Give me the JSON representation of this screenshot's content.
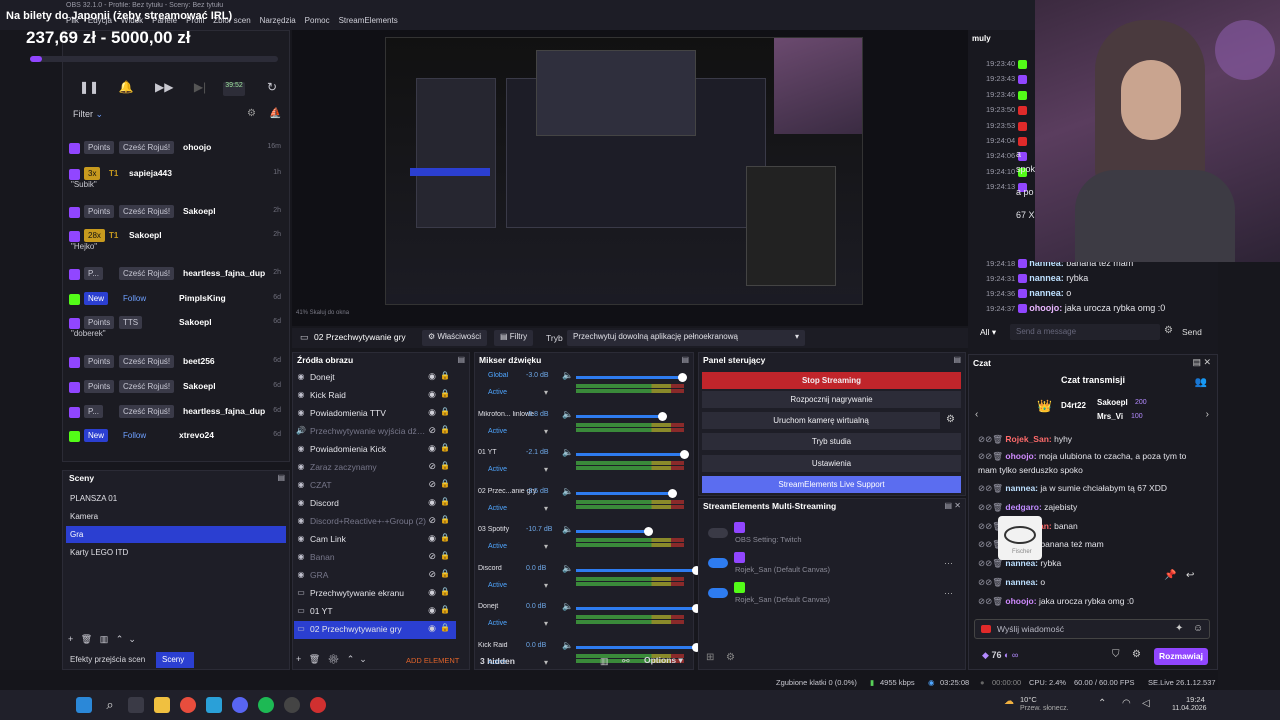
{
  "window": {
    "title": "OBS 32.1.0 - Profile: Bez tytułu - Sceny: Bez tytułu",
    "menu": [
      "Plik",
      "Edycja",
      "Widok",
      "Panele",
      "Profil",
      "Zbiór scen",
      "Narzędzia",
      "Pomoc",
      "StreamElements"
    ]
  },
  "overlay": {
    "stream_title": "Na bilety do Japonii (żeby streamować IRL)",
    "goal_text": "237,69 zł - 5000,00 zł",
    "goal_progress": 0.0475
  },
  "feed": {
    "filter_label": "Filter",
    "timer": "39:52",
    "items": [
      {
        "tag": "Points",
        "tag2": "Cześć Rojuś!",
        "name": "ohoojo",
        "time": "16m",
        "sub": ""
      },
      {
        "tag": "3x",
        "tag2": "T1",
        "name": "sapieja443",
        "time": "1h",
        "sub": "\"Subik\""
      },
      {
        "tag": "Points",
        "tag2": "Cześć Rojuś!",
        "name": "Sakoepl",
        "time": "2h",
        "sub": ""
      },
      {
        "tag": "28x",
        "tag2": "T1",
        "name": "Sakoepl",
        "time": "2h",
        "sub": "\"Hejko\""
      },
      {
        "tag": "P...",
        "tag2": "Cześć Rojuś!",
        "name": "heartless_fajna_dup",
        "time": "2h",
        "sub": ""
      },
      {
        "tag": "New",
        "tag2": "Follow",
        "name": "PimpIsKing",
        "time": "6d",
        "sub": ""
      },
      {
        "tag": "Points",
        "tag2": "TTS",
        "name": "Sakoepl",
        "time": "6d",
        "sub": "\"doberek\""
      },
      {
        "tag": "Points",
        "tag2": "Cześć Rojuś!",
        "name": "beet256",
        "time": "6d",
        "sub": ""
      },
      {
        "tag": "Points",
        "tag2": "Cześć Rojuś!",
        "name": "Sakoepl",
        "time": "6d",
        "sub": ""
      },
      {
        "tag": "P...",
        "tag2": "Cześć Rojuś!",
        "name": "heartless_fajna_dup",
        "time": "6d",
        "sub": ""
      },
      {
        "tag": "New",
        "tag2": "Follow",
        "name": "xtrevo24",
        "time": "6d",
        "sub": ""
      }
    ]
  },
  "scenes": {
    "title": "Sceny",
    "items": [
      "PLANSZA 01",
      "Kamera",
      "Gra",
      "Karty LEGO ITD"
    ],
    "selected_index": 2,
    "tab_transitions": "Efekty przejścia scen",
    "tab_scenes": "Sceny"
  },
  "scene_bar": {
    "current_source": "02 Przechwytywanie gry",
    "properties": "Właściwości",
    "filters": "Filtry",
    "mode_label": "Tryb",
    "mode_value": "Przechwytuj dowolną aplikację pełnoekranową"
  },
  "preview_footer": "41%   Skaluj do okna",
  "sources": {
    "title": "Źródła obrazu",
    "add_label": "ADD ELEMENT",
    "items": [
      {
        "name": "Donejt",
        "dim": false
      },
      {
        "name": "Kick Raid",
        "dim": false
      },
      {
        "name": "Powiadomienia TTV",
        "dim": false
      },
      {
        "name": "Przechwytywanie wyjścia dźwięk",
        "dim": true
      },
      {
        "name": "Powiadomienia Kick",
        "dim": false
      },
      {
        "name": "Zaraz zaczynamy",
        "dim": true
      },
      {
        "name": "CZAT",
        "dim": true
      },
      {
        "name": "Discord",
        "dim": false
      },
      {
        "name": "Discord+Reactive+-+Group (2)",
        "dim": true
      },
      {
        "name": "Cam Link",
        "dim": false
      },
      {
        "name": "Banan",
        "dim": true
      },
      {
        "name": "GRA",
        "dim": true
      },
      {
        "name": "Przechwytywanie ekranu",
        "dim": false
      },
      {
        "name": "01 YT",
        "dim": false
      },
      {
        "name": "02 Przechwytywanie gry",
        "dim": false
      }
    ]
  },
  "mixer": {
    "title": "Mikser dźwięku",
    "hidden_label": "3 hidden",
    "options_label": "Options",
    "tracks": [
      {
        "name": "Global",
        "db": "-3.0 dB",
        "level": 0.88
      },
      {
        "name": "Mikrofon... linlowe",
        "db": "-5.8 dB",
        "level": 0.72
      },
      {
        "name": "01 YT",
        "db": "-2.1 dB",
        "level": 0.9
      },
      {
        "name": "02 Przec...anie gry",
        "db": "-3.5 dB",
        "level": 0.8
      },
      {
        "name": "03 Spotify",
        "db": "-10.7 dB",
        "level": 0.6
      },
      {
        "name": "Discord",
        "db": "0.0 dB",
        "level": 1.0
      },
      {
        "name": "Donejt",
        "db": "0.0 dB",
        "level": 1.0
      },
      {
        "name": "Kick Raid",
        "db": "0.0 dB",
        "level": 1.0
      }
    ],
    "active_label": "Active"
  },
  "controls": {
    "title": "Panel sterujący",
    "buttons": [
      "Stop Streaming",
      "Rozpocznij nagrywanie",
      "Uruchom kamerę wirtualną",
      "Tryb studia",
      "Ustawienia",
      "StreamElements Live Support"
    ]
  },
  "multistream": {
    "title": "StreamElements Multi-Streaming",
    "rows": [
      "OBS Setting: Twitch",
      "Rojek_San (Default Canvas)",
      "Rojek_San (Default Canvas)"
    ]
  },
  "chat_top": {
    "user": "muly",
    "times": [
      "19:23:40",
      "19:23:43",
      "19:23:46",
      "19:23:50",
      "19:23:53",
      "19:24:04",
      "19:24:06",
      "19:24:10",
      "19:24:13",
      "19:24:18",
      "19:24:31",
      "19:24:36",
      "19:24:37"
    ],
    "visible": [
      {
        "time": "19:24:18",
        "name": "nannea:",
        "text": "banana też mam"
      },
      {
        "time": "19:24:31",
        "name": "nannea:",
        "text": "rybka"
      },
      {
        "time": "19:24:36",
        "name": "nannea:",
        "text": "o"
      },
      {
        "time": "19:24:37",
        "name": "ohoojo:",
        "text": "jaka urocza rybka omg :0"
      }
    ],
    "partial": [
      "a",
      "spoko",
      "a po",
      "67 X"
    ],
    "all_label": "All",
    "input_placeholder": "Send a message",
    "send_label": "Send"
  },
  "chat": {
    "panel_title": "Czat",
    "header": "Czat transmisji",
    "leaderboard": [
      {
        "name": "D4rt22",
        "points": ""
      },
      {
        "name": "Sakoepl",
        "points": "200"
      },
      {
        "name": "Mrs_Vi",
        "points": "100"
      }
    ],
    "messages": [
      {
        "name": "Rojek_San:",
        "text": "hyhy"
      },
      {
        "name": "ohoojo:",
        "text": "moja ulubiona to czacha, a poza tym to mam tylko serduszko spoko"
      },
      {
        "name": "nannea:",
        "text": "ja w sumie chciałabym tą 67 XDD"
      },
      {
        "name": "dedgaro:",
        "text": "zajebisty"
      },
      {
        "name": "Rojek_San:",
        "text": "banan"
      },
      {
        "name": "nannea:",
        "text": "banana też mam"
      },
      {
        "name": "nannea:",
        "text": "rybka"
      },
      {
        "name": "nannea:",
        "text": "o"
      },
      {
        "name": "ohoojo:",
        "text": "jaka urocza rybka omg :0"
      }
    ],
    "sticker_caption": "Fischer",
    "input_placeholder": "Wyślij wiadomość",
    "viewer_count": "76",
    "chat_button": "Rozmawiaj"
  },
  "status": {
    "dropped": "Zgubione klatki 0 (0.0%)",
    "bitrate": "4955 kbps",
    "stream_time": "03:25:08",
    "rec_time": "00:00:00",
    "cpu": "CPU: 2.4%",
    "fps": "60.00 / 60.00 FPS",
    "version": "SE.Live 26.1.12.537"
  },
  "taskbar": {
    "weather_temp": "10°C",
    "weather_desc": "Przew. słonecz.",
    "time": "19:24",
    "date": "11.04.2026"
  },
  "colors": {
    "accent_purple": "#9146ff",
    "selection_blue": "#2b3fd1",
    "stop_red": "#c0252b",
    "live_support_blue": "#5b6df0"
  }
}
